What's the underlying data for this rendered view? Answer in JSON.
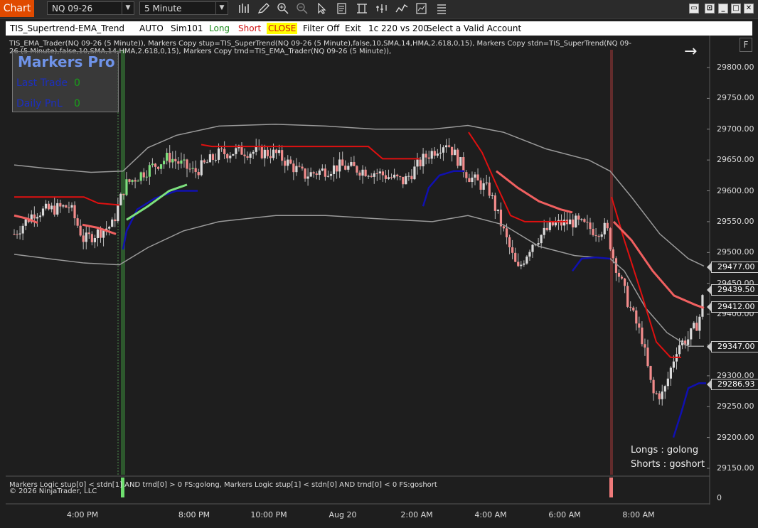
{
  "window": {
    "tab_label": "Chart",
    "instrument": "NQ 09-26",
    "interval": "5 Minute"
  },
  "toolbar_icons": [
    "bar-chart-icon",
    "draw-pencil-icon",
    "zoom-in-icon",
    "zoom-out-icon",
    "pointer-icon",
    "properties-icon",
    "data-box-icon",
    "strategies-icon",
    "indicators-icon",
    "templates-icon",
    "chart-trader-icon"
  ],
  "strategy_bar": {
    "name": "TIS_Supertrend-EMA_Trend",
    "mode": "AUTO",
    "account": "Sim101",
    "long_label": "Long",
    "short_label": "Short",
    "close_label": "CLOSE",
    "filter_label": "Filter Off",
    "exit_label": "Exit",
    "ratio": "1c 220 vs 200",
    "account_prompt": "Select a Valid Account"
  },
  "indicator_text": "TIS_EMA_Trader(NQ 09-26 (5 Minute)), Markers Copy stup=TIS_SuperTrend(NQ 09-26 (5 Minute),false,10,SMA,14,HMA,2.618,0,15), Markers Copy stdn=TIS_SuperTrend(NQ 09-26 (5 Minute),false,10,SMA,14,HMA,2.618,0,15), Markers Copy trnd=TIS_EMA_Trader(NQ 09-26 (5 Minute)),",
  "markers_box": {
    "title": "Markers Pro",
    "last_trade_label": "Last Trade",
    "last_trade_value": "0",
    "daily_pnl_label": "Daily PnL",
    "daily_pnl_value": "0"
  },
  "legend": {
    "longs": "Longs : golong",
    "shorts": "Shorts : goshort"
  },
  "bottom_logic": "Markers Logic stup[0] < stdn[1] AND trnd[0] > 0  FS:golong, Markers Logic stup[1] < stdn[0] AND trnd[0] < 0  FS:goshort",
  "copyright": "© 2026 NinjaTrader, LLC",
  "colors": {
    "up_candle": "#d9d9d9",
    "down_candle": "#f28b8b",
    "long_candle": "#7de07d",
    "supertrend_up": "#1010b0",
    "supertrend_dn": "#e01010",
    "ema": "#f06060",
    "band": "#9a9a9a",
    "accent": "#e04a00"
  },
  "chart_data": {
    "type": "candlestick",
    "instrument": "NQ 09-26",
    "interval": "5 Minute",
    "y_ticks": [
      29800,
      29750,
      29700,
      29650,
      29600,
      29550,
      29500,
      29450,
      29400,
      29350,
      29300,
      29250,
      29200,
      29150
    ],
    "y_tick_labels": [
      "29800.00",
      "29750.00",
      "29700.00",
      "29650.00",
      "29600.00",
      "29550.00",
      "29500.00",
      "29450.00",
      "29400.00",
      "29350.00",
      "29300.00",
      "29250.00",
      "29200.00",
      "29150.00"
    ],
    "ylim": [
      29130,
      29840
    ],
    "x_tick_labels": [
      "4:00 PM",
      "8:00 PM",
      "10:00 PM",
      "Aug 20",
      "2:00 AM",
      "4:00 AM",
      "6:00 AM",
      "8:00 AM"
    ],
    "price_markers": [
      "29477.00",
      "29439.50",
      "29412.00",
      "29347.00",
      "29286.93"
    ],
    "lower_panel_tick": "0"
  }
}
